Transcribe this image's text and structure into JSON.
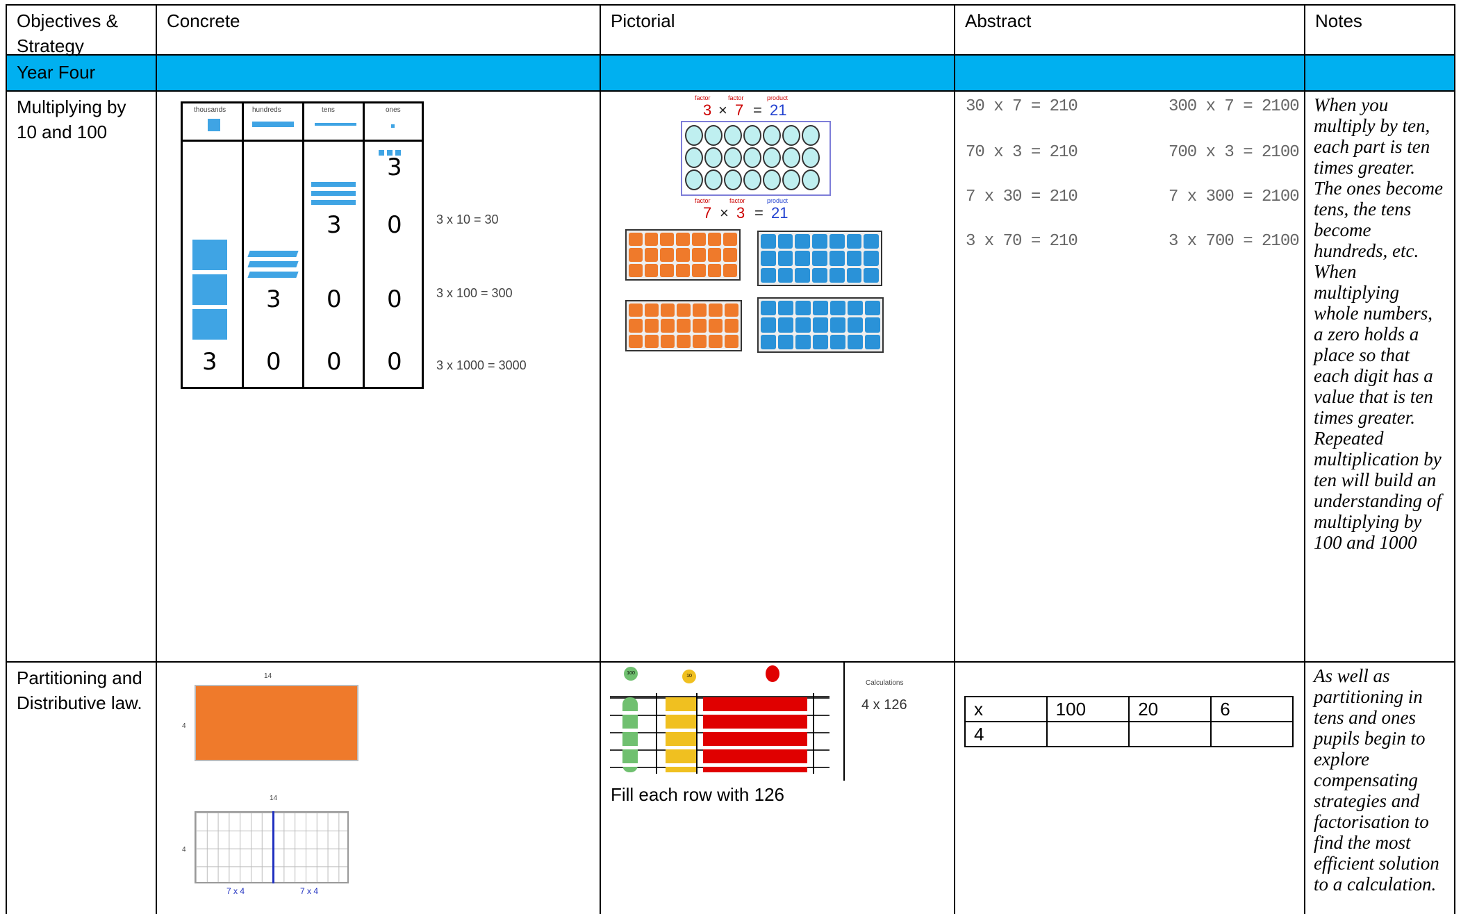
{
  "header": {
    "col1": "Objectives & Strategy",
    "col2": "Concrete",
    "col3": "Pictorial",
    "col4": "Abstract",
    "col5": "Notes"
  },
  "band": {
    "label": "Year Four",
    "color": "#00b0f0"
  },
  "row1": {
    "objective": "Multiplying by 10 and 100",
    "concrete": {
      "column_headers": [
        "thousands",
        "hundreds",
        "tens",
        "ones"
      ],
      "digit_rows": [
        [
          "",
          "",
          "",
          "3"
        ],
        [
          "",
          "",
          "3",
          "0"
        ],
        [
          "",
          "3",
          "0",
          "0"
        ],
        [
          "3",
          "0",
          "0",
          "0"
        ]
      ],
      "equations": [
        "3 x 10 = 30",
        "3 x 100 = 300",
        "3 x 1000 = 3000"
      ]
    },
    "pictorial": {
      "top_labels": [
        "factor",
        "factor",
        "product"
      ],
      "top_equation": [
        "3",
        "×",
        "7",
        "=",
        "21"
      ],
      "bottom_labels": [
        "factor",
        "factor",
        "product"
      ],
      "bottom_equation": [
        "7",
        "×",
        "3",
        "=",
        "21"
      ]
    },
    "abstract": {
      "left": [
        "30 x 7 = 210",
        "70 x 3 = 210",
        "7 x 30 = 210",
        "3 x 70 = 210"
      ],
      "right": [
        "300 x 7 = 2100",
        "700 x 3 = 2100",
        "7 x 300 = 2100",
        "3 x 700 = 2100"
      ]
    },
    "notes": "When you multiply by ten, each part is ten times greater. The ones become tens, the tens become hundreds, etc. When multiplying whole numbers, a zero holds a place so that each digit has a value that is ten times greater. Repeated multiplication by ten will build an understanding of multiplying by 100 and 1000"
  },
  "row2": {
    "objective": "Partitioning and Distributive law.",
    "concrete": {
      "top_width": "14",
      "side": "4",
      "bottom_width": "14",
      "bottom_side": "4",
      "bottom_left": "7 x 4",
      "bottom_right": "7 x 4"
    },
    "pictorial": {
      "counters": [
        "100",
        "10",
        "1"
      ],
      "calc_heading": "Calculations",
      "calc_expr": "4 x 126",
      "caption": "Fill each row with 126"
    },
    "abstract": {
      "grid": [
        [
          "x",
          "100",
          "20",
          "6"
        ],
        [
          "4",
          "",
          "",
          ""
        ]
      ]
    },
    "notes": "As well as partitioning in tens and ones pupils begin to explore compensating strategies and factorisation to find the most efficient solution to a calculation."
  }
}
